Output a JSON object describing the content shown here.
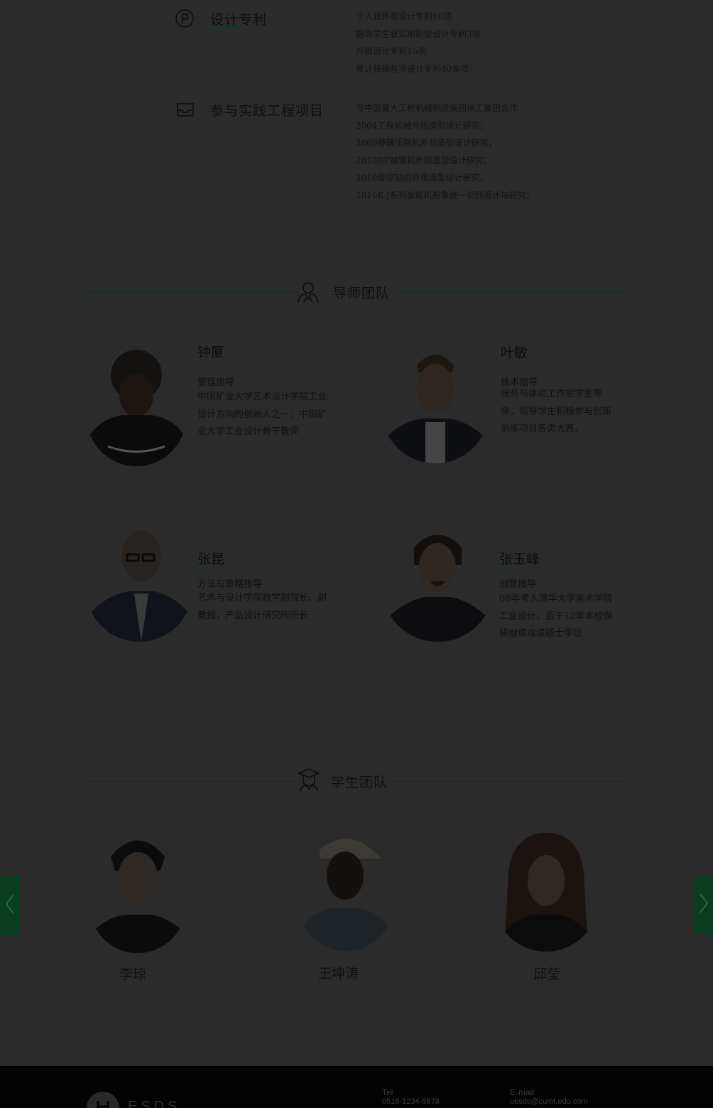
{
  "achievements": [
    {
      "icon": "patent-icon",
      "title": "设计专利",
      "lines": [
        "个人获外观设计专利10项",
        "指导学生获实用新型设计专利3项",
        "外观设计专利15项",
        "累计获得各项设计专利40余项"
      ]
    },
    {
      "icon": "inbox-tray-icon",
      "title": "参与实践工程项目",
      "lines": [
        "与中国最大工程机械制造集团徐工集团合作",
        "2004工程机械外观造型设计研究；",
        "2009静辗压路机外观造型设计研究；",
        "2010RP摊铺机外观造型设计研究；",
        "2010旋挖钻机外观造型设计研究；",
        "2010K-J系列装载机形象统一识别设计与研究；"
      ]
    }
  ],
  "mentor_section": {
    "title": "导师团队",
    "icon": "person-group-icon"
  },
  "mentors": [
    {
      "name": "钟厦",
      "role": "管理指导",
      "desc": "中国矿业大学艺术设计学院工业设计方向的创始人之一；中国矿业大学工业设计骨干教师"
    },
    {
      "name": "叶敏",
      "role": "技术指导",
      "desc": "服务与体验工作室学生导师，指导学生积极参与创新训练项目各类大赛。"
    },
    {
      "name": "张昆",
      "role": "方法与策略指导",
      "desc": "艺术与设计学院教学副院长、副教授，产品设计研究所所长"
    },
    {
      "name": "张玉峰",
      "role": "创意指导",
      "desc": "08年考入清华大学美术学院工业设计，后于12年本校保研继续攻读硕士学位"
    }
  ],
  "student_section": {
    "title": "学生团队",
    "icon": "graduate-icon"
  },
  "students": [
    {
      "name": "李琼"
    },
    {
      "name": "王坤涛"
    },
    {
      "name": "邱莹"
    }
  ],
  "carousel": {
    "prev_icon": "chevron-left-icon",
    "next_icon": "chevron-right-icon"
  },
  "footer": {
    "logo_text": "ESDS",
    "tel_label": "Tel",
    "tel_value": "0516-1234-5678",
    "email_label": "E-mail",
    "email_value": "uesds@cumt.edu.com"
  },
  "colors": {
    "overlay": "#2b2b2b",
    "accent": "#0b3d23",
    "footer_bg": "#030303"
  }
}
